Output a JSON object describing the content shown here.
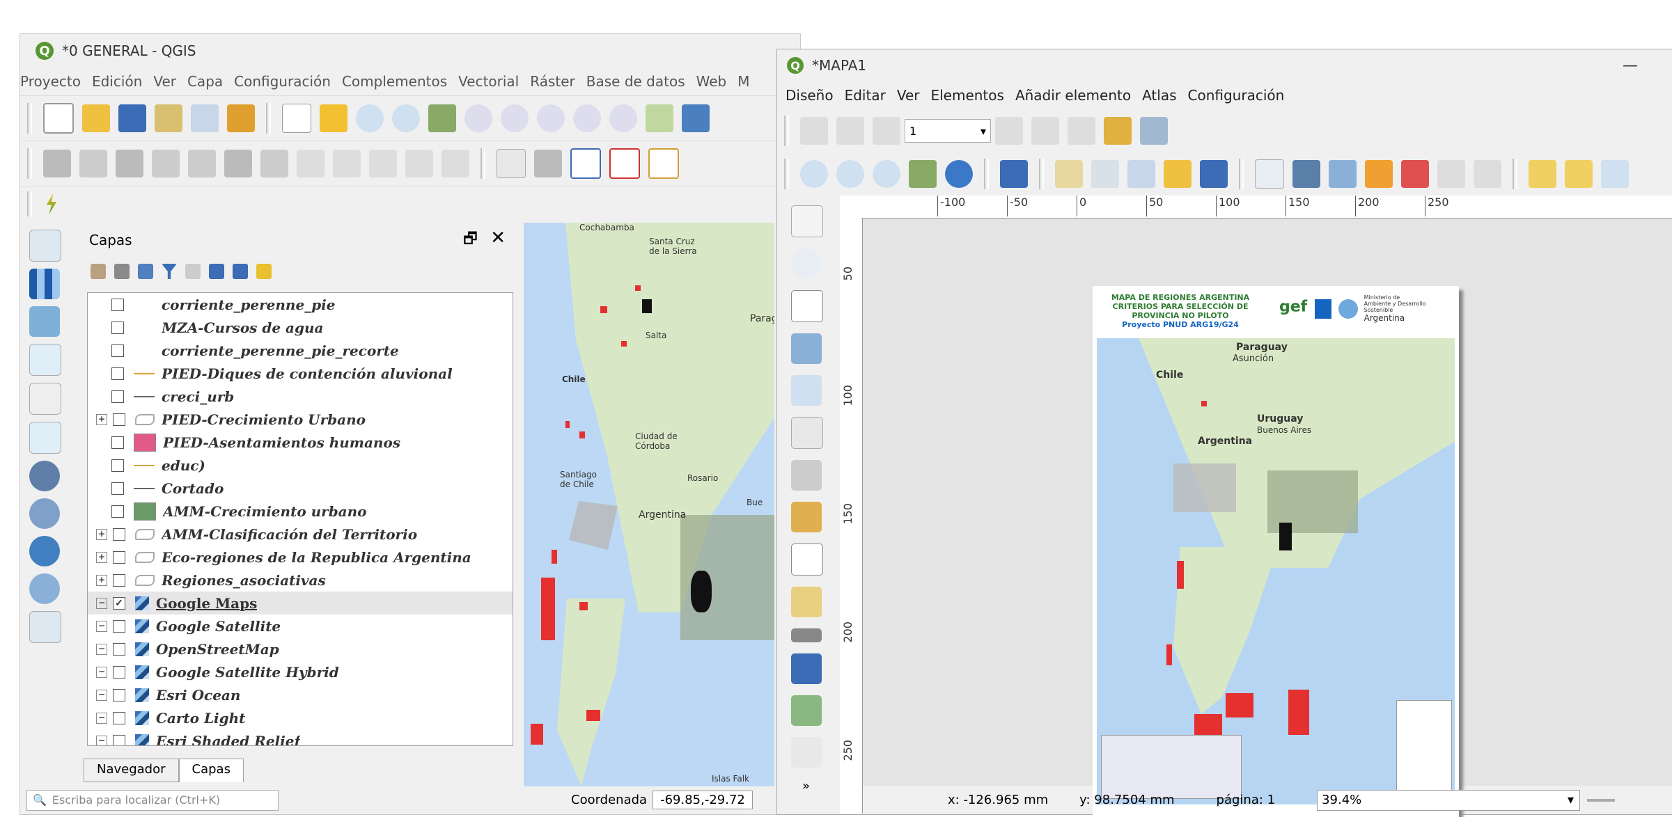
{
  "qgis": {
    "title": "*0 GENERAL - QGIS",
    "menu": [
      "Proyecto",
      "Edición",
      "Ver",
      "Capa",
      "Configuración",
      "Complementos",
      "Vectorial",
      "Ráster",
      "Base de datos",
      "Web",
      "M"
    ],
    "layers_panel": {
      "title": "Capas",
      "tabs": [
        "Navegador",
        "Capas"
      ],
      "items": [
        {
          "label": "corriente_perenne_pie",
          "expander": "",
          "checked": "",
          "symbol": "none"
        },
        {
          "label": "MZA-Cursos de agua",
          "expander": "",
          "checked": "",
          "symbol": "none"
        },
        {
          "label": "corriente_perenne_pie_recorte",
          "expander": "",
          "checked": "",
          "symbol": "none"
        },
        {
          "label": "PIED-Diques de contención aluvional",
          "expander": "",
          "checked": "",
          "symbol": "orange"
        },
        {
          "label": "creci_urb",
          "expander": "",
          "checked": "",
          "symbol": "line"
        },
        {
          "label": "PIED-Crecimiento Urbano",
          "expander": "+",
          "checked": "",
          "symbol": "poly"
        },
        {
          "label": "PIED-Asentamientos humanos",
          "expander": "",
          "checked": "",
          "symbol": "red"
        },
        {
          "label": "educ)",
          "expander": "",
          "checked": "",
          "symbol": "orange"
        },
        {
          "label": "Cortado",
          "expander": "",
          "checked": "",
          "symbol": "line"
        },
        {
          "label": "AMM-Crecimiento urbano",
          "expander": "",
          "checked": "",
          "symbol": "green"
        },
        {
          "label": "AMM-Clasificación del Territorio",
          "expander": "+",
          "checked": "",
          "symbol": "poly"
        },
        {
          "label": "Eco-regiones de la Republica Argentina",
          "expander": "+",
          "checked": "",
          "symbol": "poly"
        },
        {
          "label": "Regiones_asociativas",
          "expander": "+",
          "checked": "",
          "symbol": "poly"
        },
        {
          "label": "Google Maps",
          "expander": "−",
          "checked": "✓",
          "symbol": "tile"
        },
        {
          "label": "Google Satellite",
          "expander": "−",
          "checked": "",
          "symbol": "tile"
        },
        {
          "label": "OpenStreetMap",
          "expander": "−",
          "checked": "",
          "symbol": "tile"
        },
        {
          "label": "Google Satellite Hybrid",
          "expander": "−",
          "checked": "",
          "symbol": "tile"
        },
        {
          "label": "Esri Ocean",
          "expander": "−",
          "checked": "",
          "symbol": "tile"
        },
        {
          "label": "Carto Light",
          "expander": "−",
          "checked": "",
          "symbol": "tile"
        },
        {
          "label": "Esri Shaded Relief",
          "expander": "−",
          "checked": "",
          "symbol": "tile"
        }
      ]
    },
    "map_labels": {
      "l1": "Cochabamba",
      "l2": "Santa Cruz de la Sierra",
      "l3": "Parag",
      "l4": "Chile",
      "l5": "Salta",
      "l6": "Ciudad de Córdoba",
      "l7": "Santiago de Chile",
      "l8": "Rosario",
      "l9": "Argentina",
      "l10": "Bue",
      "l11": "Islas Falk"
    },
    "status": {
      "locator_placeholder": "Escriba para localizar (Ctrl+K)",
      "coord_label": "Coordenada",
      "coord_value": "-69.85,-29.72"
    }
  },
  "composer": {
    "title": "*MAPA1",
    "menu": [
      "Diseño",
      "Editar",
      "Ver",
      "Elementos",
      "Añadir elemento",
      "Atlas",
      "Configuración"
    ],
    "atlas_page": "1",
    "ruler_h": [
      "-100",
      "-50",
      "0",
      "50",
      "100",
      "150",
      "200",
      "250"
    ],
    "ruler_v": [
      "50",
      "100",
      "150",
      "200",
      "250"
    ],
    "page": {
      "title_line1": "MAPA DE REGIONES ARGENTINA",
      "title_line2": "CRITERIOS PARA SELECCIÓN DE",
      "title_line3": "PROVINCIA NO PILOTO",
      "title_line4": "Proyecto PNUD ARG19/G24",
      "logo_text": "gef",
      "ministry": "Ministerio de Ambiente y Desarrollo Sostenible",
      "country": "Argentina",
      "map_labels": {
        "paraguay": "Paraguay",
        "asuncion": "Asunción",
        "chile": "Chile",
        "uruguay": "Uruguay",
        "argentina": "Argentina",
        "buenos_aires": "Buenos Aires"
      }
    },
    "status": {
      "x": "x: -126.965 mm",
      "y": "y: 98.7504 mm",
      "page": "página: 1",
      "zoom": "39.4%"
    }
  }
}
